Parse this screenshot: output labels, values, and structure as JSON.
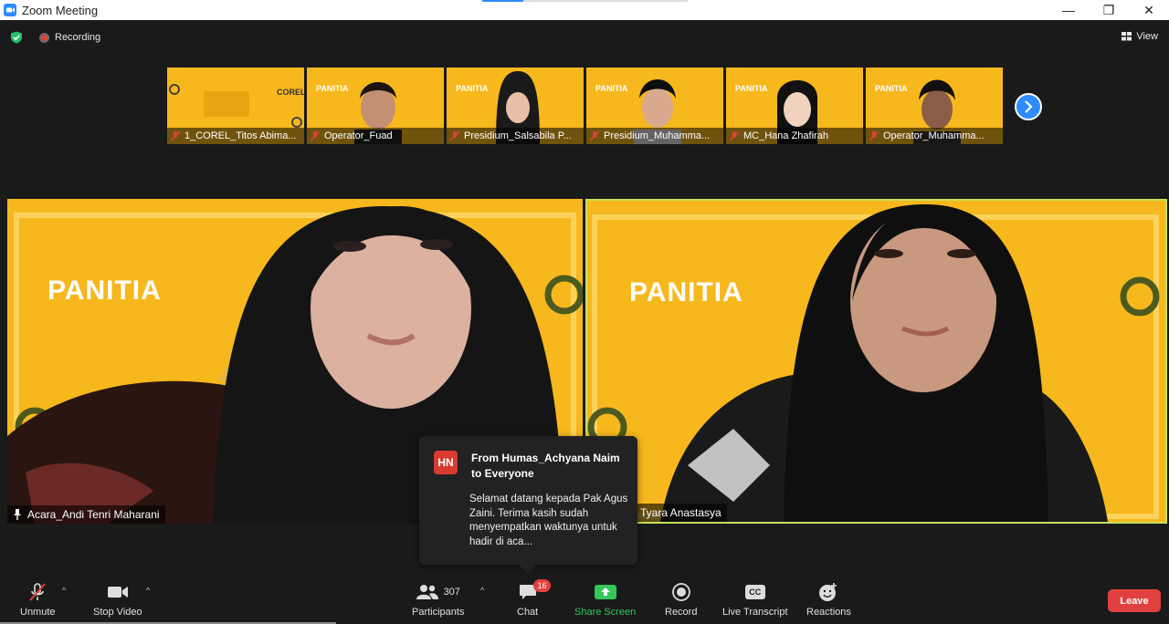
{
  "window": {
    "title": "Zoom Meeting",
    "minimize": "—",
    "restore": "❐",
    "close": "✕"
  },
  "topbar": {
    "recording_label": "Recording",
    "view_label": "View"
  },
  "thumbnails": [
    {
      "name": "1_COREL_Titos Abima...",
      "banner": ""
    },
    {
      "name": "Operator_Fuad",
      "banner": "PANITIA"
    },
    {
      "name": "Presidium_Salsabila P...",
      "banner": "PANITIA"
    },
    {
      "name": "Presidium_Muhamma...",
      "banner": "PANITIA"
    },
    {
      "name": "MC_Hana Zhafirah",
      "banner": "PANITIA"
    },
    {
      "name": "Operator_Muhamma...",
      "banner": "PANITIA"
    }
  ],
  "videos": {
    "left": {
      "banner": "PANITIA",
      "name": "Acara_Andi Tenri Maharani"
    },
    "right": {
      "banner": "PANITIA",
      "name": "Tyara Anastasya"
    }
  },
  "chat_popup": {
    "initials": "HN",
    "from_line1": "From Humas_Achyana Naim",
    "from_line2": "to Everyone",
    "message": "Selamat datang kepada Pak Agus Zaini. Terima kasih sudah menyempatkan waktunya untuk hadir di aca..."
  },
  "toolbar": {
    "unmute": "Unmute",
    "stop_video": "Stop Video",
    "participants": "Participants",
    "participants_count": "307",
    "chat": "Chat",
    "chat_badge": "16",
    "share_screen": "Share Screen",
    "record": "Record",
    "live_transcript": "Live Transcript",
    "cc": "CC",
    "reactions": "Reactions",
    "leave": "Leave"
  },
  "colors": {
    "accent": "#2d8cff",
    "danger": "#e0413f",
    "share": "#34c759",
    "background_yellow": "#f7b81d",
    "active_speaker": "#c5e15b"
  }
}
